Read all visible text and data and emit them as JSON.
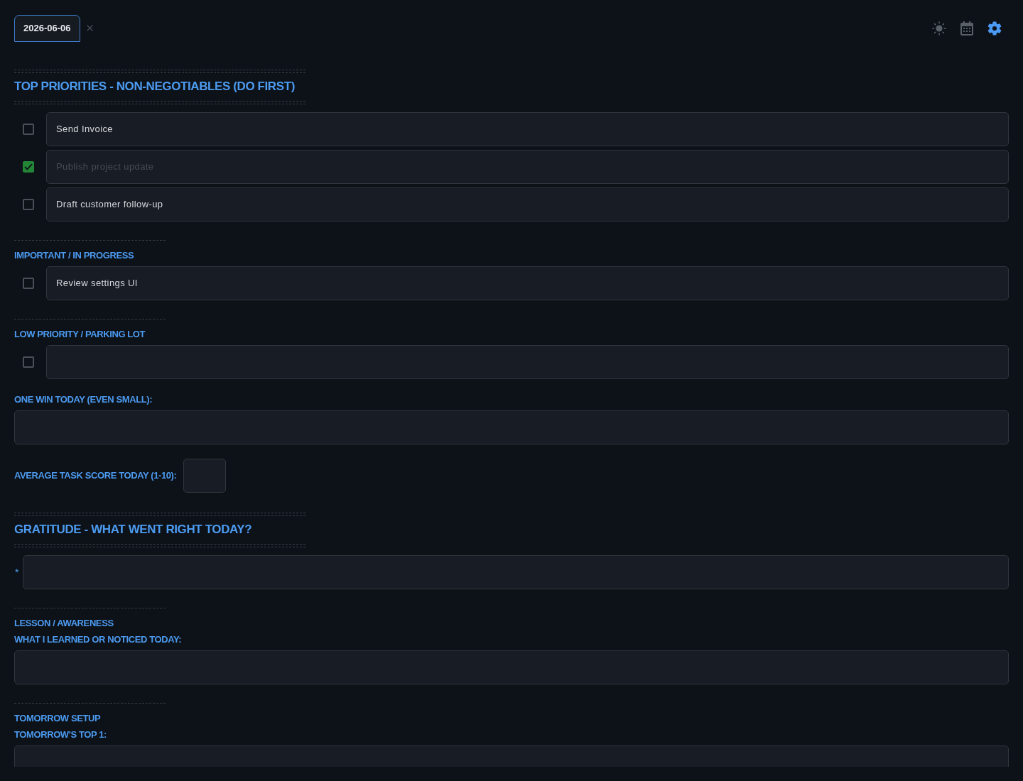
{
  "tabs": [
    {
      "label": "2026-06-06",
      "selected": true
    }
  ],
  "toolbar": [
    {
      "kind": "theme",
      "selected": false
    },
    {
      "kind": "calendar",
      "selected": false
    },
    {
      "kind": "settings",
      "selected": true
    }
  ],
  "sections": [
    {
      "kind": "major",
      "title": "TOP PRIORITIES - NON-NEGOTIABLES (DO FIRST)",
      "items": [
        {
          "kind": "task",
          "checked": false,
          "value": "Send Invoice"
        },
        {
          "kind": "task",
          "checked": true,
          "value": "Publish project update"
        },
        {
          "kind": "task",
          "checked": false,
          "value": "Draft customer follow-up"
        }
      ]
    },
    {
      "kind": "minor",
      "title": "IMPORTANT / IN PROGRESS",
      "items": [
        {
          "kind": "task",
          "checked": false,
          "value": "Review settings UI"
        }
      ]
    },
    {
      "kind": "minor",
      "title": "LOW PRIORITY / PARKING LOT",
      "items": [
        {
          "kind": "task",
          "checked": false
        },
        {
          "kind": "field",
          "label": "ONE WIN TODAY (EVEN SMALL):"
        },
        {
          "kind": "inline_field",
          "label": "AVERAGE TASK SCORE TODAY (1-10):"
        }
      ]
    },
    {
      "kind": "major",
      "title": "GRATITUDE - WHAT WENT RIGHT TODAY?",
      "items": [
        {
          "kind": "bullet_field",
          "bullet": "*"
        }
      ]
    },
    {
      "kind": "minor",
      "title": "LESSON / AWARENESS",
      "items": [
        {
          "kind": "field",
          "label": "WHAT I LEARNED OR NOTICED TODAY:"
        }
      ]
    },
    {
      "kind": "minor",
      "title": "TOMORROW SETUP",
      "items": [
        {
          "kind": "field",
          "label": "TOMORROW'S TOP 1:"
        }
      ]
    }
  ]
}
